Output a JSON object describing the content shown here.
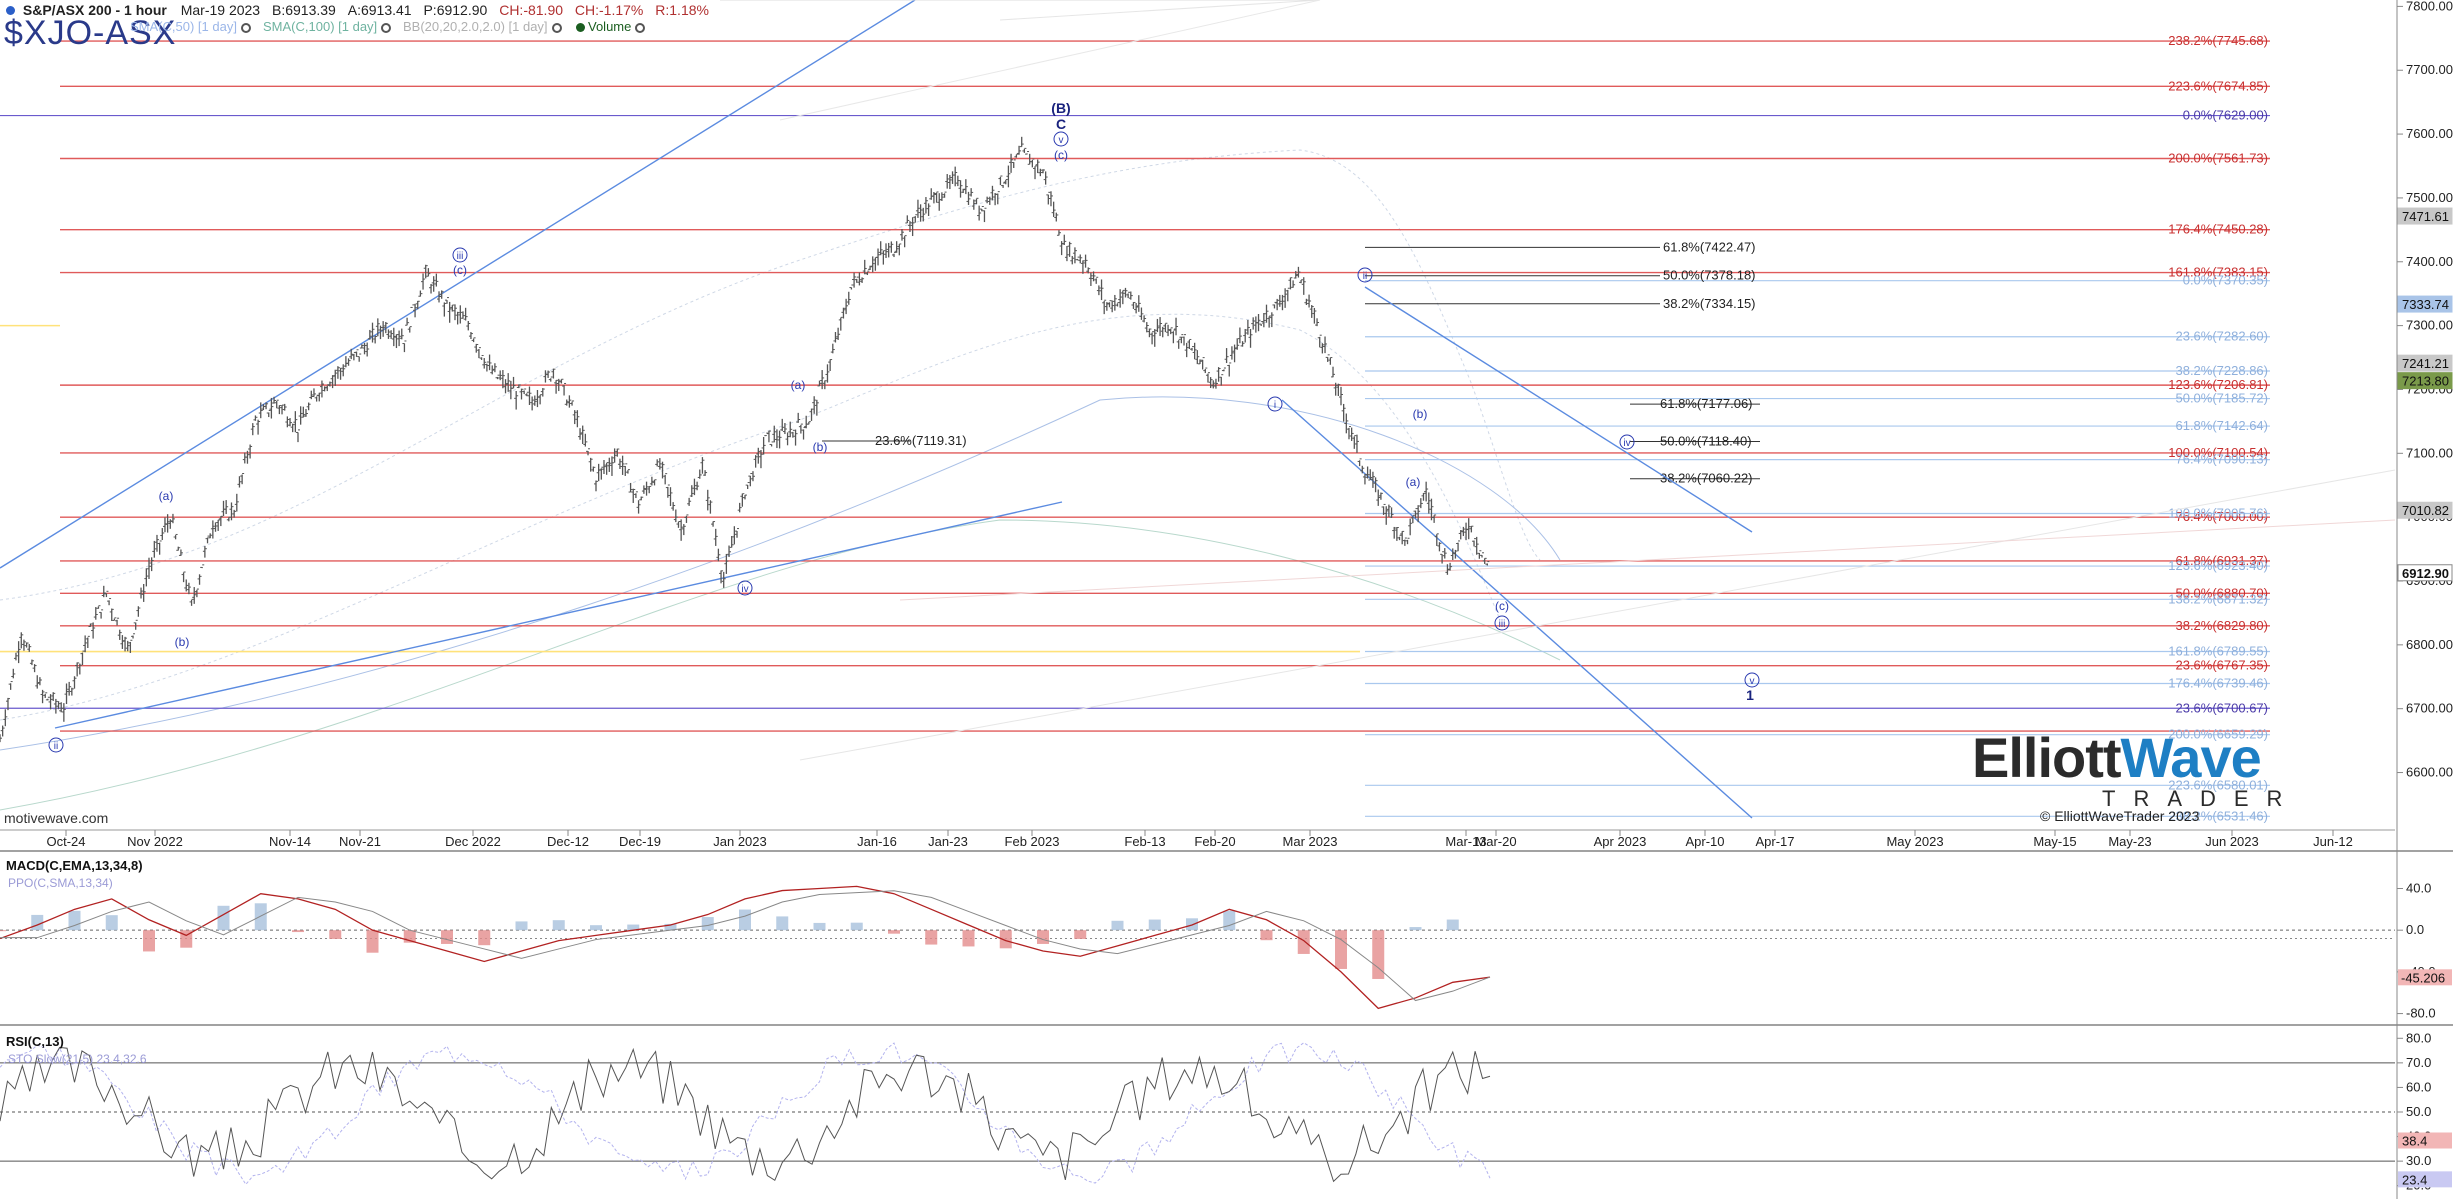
{
  "header": {
    "title": "S&P/ASX 200 - 1 hour",
    "date": "Mar-19 2023",
    "bid": "B:6913.39",
    "ask": "A:6913.41",
    "price": "P:6912.90",
    "change": "CH:-81.90",
    "change_pct": "CH:-1.17%",
    "r": "R:1.18%",
    "symbol": "$XJO-ASX",
    "indicators": [
      {
        "label": "SMA(C,50) [1 day]",
        "color": "#9bb6e8"
      },
      {
        "label": "SMA(C,100) [1 day]",
        "color": "#6fb3a0"
      },
      {
        "label": "BB(20,20,2.0,2.0) [1 day]",
        "color": "#b0b0b0"
      },
      {
        "label": "Volume",
        "color": "#1b5e20"
      }
    ]
  },
  "watermark": {
    "source": "motivewave.com",
    "copyright": "© ElliottWaveTrader 2023",
    "logo_word1": "Elliott",
    "logo_word2": "Wave",
    "logo_sub": "TRADER"
  },
  "chart_data": [
    {
      "type": "candlestick",
      "title": "S&P/ASX 200 - 1 hour",
      "ylim": [
        6510,
        7810
      ],
      "y_ticks": [
        7800,
        7700,
        7600,
        7500,
        7400,
        7300,
        7200,
        7100,
        7000,
        6900,
        6800,
        6700,
        6600
      ],
      "x_ticks": [
        "Oct-24",
        "Nov 2022",
        "Nov-14",
        "Nov-21",
        "Dec 2022",
        "Dec-12",
        "Dec-19",
        "Jan 2023",
        "Jan-16",
        "Jan-23",
        "Feb 2023",
        "Feb-13",
        "Feb-20",
        "Mar 2023",
        "Mar-13",
        "Mar-20",
        "Apr 2023",
        "Apr-10",
        "Apr-17",
        "May 2023",
        "May-15",
        "May-23",
        "Jun 2023",
        "Jun-12"
      ],
      "price_path": [
        6650,
        6820,
        6720,
        6700,
        6800,
        6880,
        6790,
        6920,
        7000,
        6860,
        6990,
        7010,
        7150,
        7180,
        7140,
        7200,
        7230,
        7260,
        7300,
        7280,
        7380,
        7330,
        7300,
        7230,
        7200,
        7180,
        7230,
        7160,
        7060,
        7100,
        7020,
        7080,
        6980,
        7080,
        6900,
        7040,
        7120,
        7130,
        7150,
        7240,
        7360,
        7400,
        7420,
        7470,
        7500,
        7530,
        7480,
        7520,
        7570,
        7540,
        7420,
        7400,
        7330,
        7350,
        7290,
        7300,
        7260,
        7210,
        7260,
        7300,
        7330,
        7380,
        7290,
        7180,
        7080,
        7020,
        6960,
        7040,
        6920,
        6990,
        6912
      ],
      "price_labels": [
        {
          "label": "7471.61",
          "value": 7471.61,
          "color": "#c8c8c8"
        },
        {
          "label": "7333.74",
          "value": 7333.74,
          "color": "#a9c4e8"
        },
        {
          "label": "7241.21",
          "value": 7241.21,
          "color": "#c8c8c8"
        },
        {
          "label": "7213.80",
          "value": 7213.8,
          "color": "#7a9a4a"
        },
        {
          "label": "7010.82",
          "value": 7010.82,
          "color": "#c8c8c8"
        },
        {
          "label": "6912.90",
          "value": 6912.9,
          "color": "#ffffff"
        }
      ],
      "fib_lines_red": [
        {
          "label": "238.2%(7745.68)",
          "value": 7745.68
        },
        {
          "label": "223.6%(7674.85)",
          "value": 7674.85
        },
        {
          "label": "200.0%(7561.73)",
          "value": 7561.73
        },
        {
          "label": "176.4%(7450.28)",
          "value": 7450.28
        },
        {
          "label": "161.8%(7383.15)",
          "value": 7383.15
        },
        {
          "label": "123.6%(7206.81)",
          "value": 7206.81
        },
        {
          "label": "100.0%(7100.54)",
          "value": 7100.54
        },
        {
          "label": "76.4%(7000.00)",
          "value": 7000.0
        },
        {
          "label": "61.8%(6931.37)",
          "value": 6931.37
        },
        {
          "label": "50.0%(6880.70)",
          "value": 6880.7
        },
        {
          "label": "38.2%(6829.80)",
          "value": 6829.8
        },
        {
          "label": "23.6%(6767.35)",
          "value": 6767.35
        },
        {
          "label": "",
          "value": 6665
        }
      ],
      "fib_lines_blue": [
        {
          "label": "0.0%(7370.35)",
          "value": 7370.35
        },
        {
          "label": "23.6%(7282.60)",
          "value": 7282.6
        },
        {
          "label": "38.2%(7228.86)",
          "value": 7228.86
        },
        {
          "label": "50.0%(7185.72)",
          "value": 7185.72
        },
        {
          "label": "61.8%(7142.64)",
          "value": 7142.64
        },
        {
          "label": "76.4%(7090.13)",
          "value": 7090.13
        },
        {
          "label": "100.0%(7005.76)",
          "value": 7005.76
        },
        {
          "label": "123.6%(6923.40)",
          "value": 6923.4
        },
        {
          "label": "138.2%(6871.32)",
          "value": 6871.32
        },
        {
          "label": "161.8%(6789.55)",
          "value": 6789.55
        },
        {
          "label": "176.4%(6739.46)",
          "value": 6739.46
        },
        {
          "label": "200.0%(6659.29)",
          "value": 6659.29
        },
        {
          "label": "223.6%(6580.01)",
          "value": 6580.01
        },
        {
          "label": "238.2%(6531.46)",
          "value": 6531.46
        }
      ],
      "fib_lines_purple": [
        {
          "label": "0.0%(7629.00)",
          "value": 7629.0
        },
        {
          "label": "23.6%(6700.67)",
          "value": 6700.67
        }
      ],
      "fib_lines_gray": [
        {
          "label": "61.8%(7422.47)",
          "value": 7422.47
        },
        {
          "label": "50.0%(7378.18)",
          "value": 7378.18
        },
        {
          "label": "38.2%(7334.15)",
          "value": 7334.15
        },
        {
          "label": "61.8%(7177.06)",
          "value": 7177.06
        },
        {
          "label": "50.0%(7118.40)",
          "value": 7118.4
        },
        {
          "label": "38.2%(7060.22)",
          "value": 7060.22
        },
        {
          "label": "23.6%(7119.31)",
          "value": 7119.31
        }
      ],
      "wave_labels": [
        "ii",
        "a",
        "b",
        "iii",
        "c",
        "iv",
        "a",
        "b",
        "(B)",
        "C",
        "v",
        "c",
        "i",
        "ii",
        "b",
        "a",
        "c",
        "iii",
        "iv",
        "v",
        "1"
      ]
    },
    {
      "type": "line",
      "title": "MACD(C,EMA,13,34,8)",
      "subtitle": "PPO(C,SMA,13,34)",
      "y_ticks": [
        40.0,
        0.0,
        -40.0,
        -80.0
      ],
      "ylim": [
        -90,
        75
      ],
      "value_label": "-45.206"
    },
    {
      "type": "line",
      "title": "RSI(C,13)",
      "subtitle": "STO Slow(21,5) 23.4,32.6",
      "y_ticks": [
        80.0,
        70.0,
        60.0,
        50.0,
        40.0,
        30.0,
        20.0
      ],
      "ylim": [
        15,
        85
      ],
      "value_labels": [
        "38.4",
        "23.4"
      ]
    }
  ]
}
